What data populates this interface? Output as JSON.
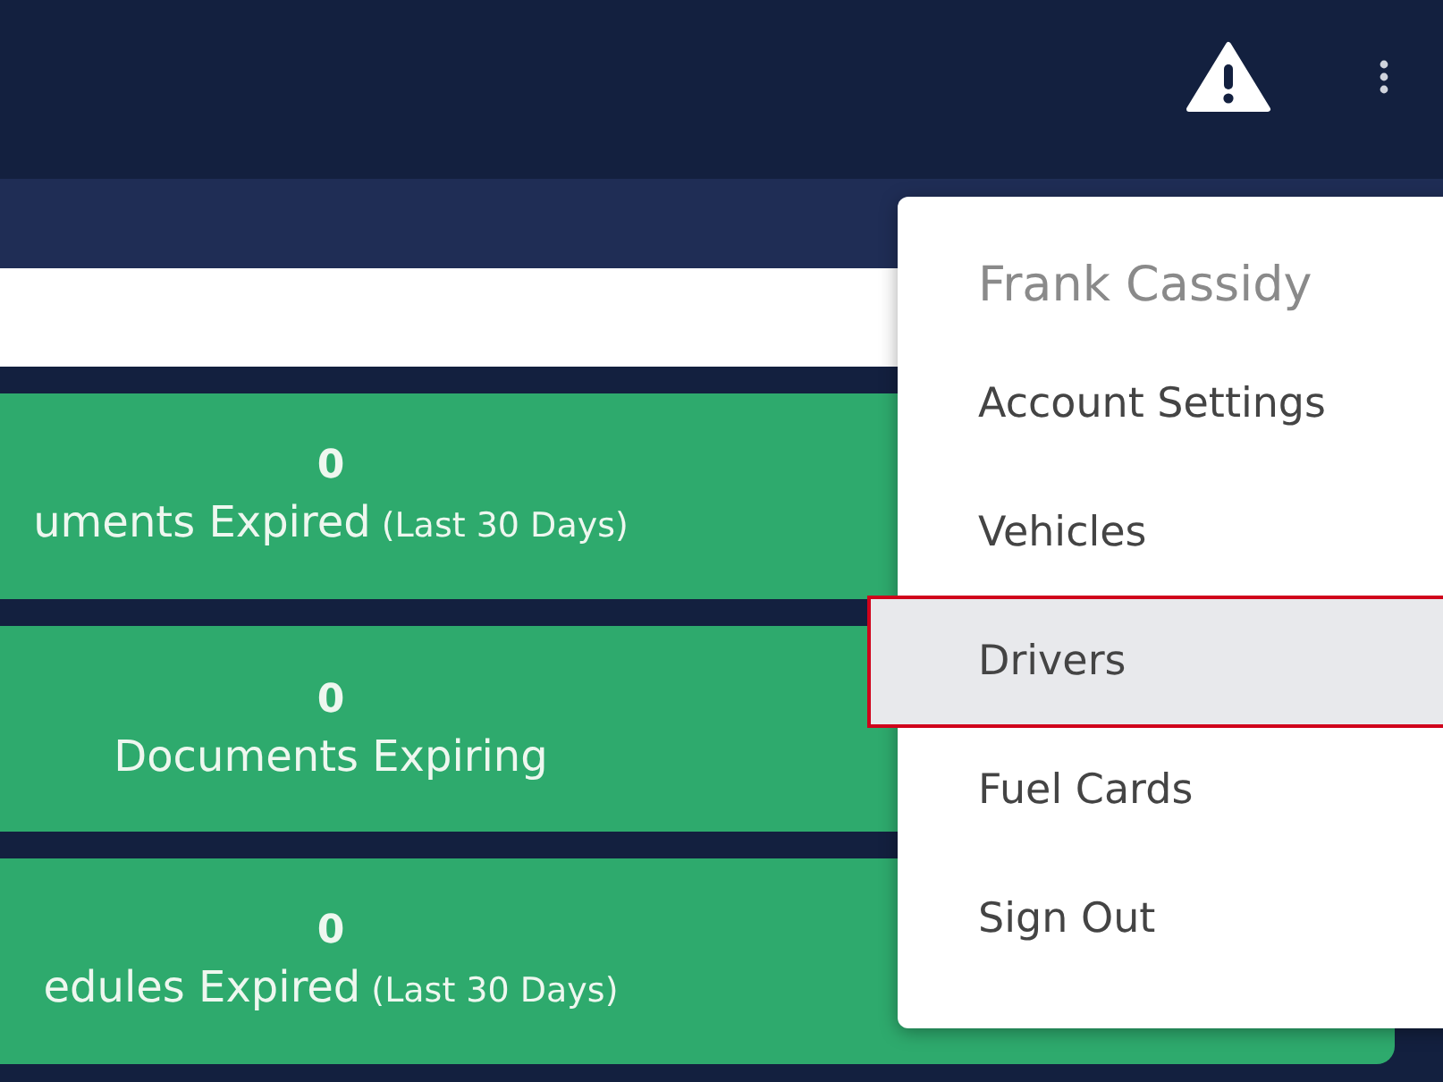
{
  "stat_cards": [
    {
      "count": "0",
      "label": "uments Expired",
      "note": "(Last 30 Days)"
    },
    {
      "count": "0",
      "label": "Documents Expiring"
    },
    {
      "count": "0",
      "label": "edules Expired",
      "note": "(Last 30 Days)"
    }
  ],
  "user_menu": {
    "user_name": "Frank Cassidy",
    "items": [
      {
        "label": "Account Settings",
        "selected": false
      },
      {
        "label": "Vehicles",
        "selected": false
      },
      {
        "label": "Drivers",
        "selected": true
      },
      {
        "label": "Fuel Cards",
        "selected": false
      },
      {
        "label": "Sign Out",
        "selected": false
      }
    ]
  }
}
